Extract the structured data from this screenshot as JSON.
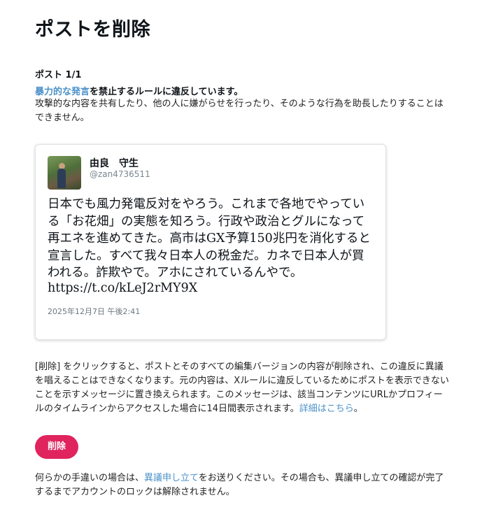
{
  "page": {
    "title": "ポストを削除"
  },
  "post_count": "ポスト 1/1",
  "violation": {
    "rule_link": "暴力的な発言",
    "rule_suffix": "を禁止するルールに違反しています。",
    "description": "攻撃的な内容を共有したり、他の人に嫌がらせを行ったり、そのような行為を助長したりすることはできません。"
  },
  "tweet": {
    "display_name": "由良　守生",
    "handle": "@zan4736511",
    "text": "日本でも風力発電反対をやろう。これまで各地でやっている「お花畑」の実態を知ろう。行政や政治とグルになって再エネを進めてきた。高市はGX予算150兆円を消化すると宣言した。すべて我々日本人の税金だ。カネで日本人が買われる。詐欺やで。アホにされているんやで。",
    "link": "https://t.co/kLeJ2rMY9X",
    "date": "2025年12月7日 午後2:41"
  },
  "info": {
    "text": "[削除] をクリックすると、ポストとそのすべての編集バージョンの内容が削除され、この違反に異議を唱えることはできなくなります。元の内容は、Xルールに違反しているためにポストを表示できないことを示すメッセージに置き換えられます。このメッセージは、該当コンテンツにURLかプロフィールのタイムラインからアクセスした場合に14日間表示されます。",
    "details_link": "詳細はこちら",
    "trailing": "。"
  },
  "delete_button": {
    "label": "削除"
  },
  "appeal": {
    "prefix": "何らかの手違いの場合は、",
    "link": "異議申し立て",
    "suffix": "をお送りください。その場合も、異議申し立ての確認が完了するまでアカウントのロックは解除されません。"
  },
  "colors": {
    "link": "#4a90c9",
    "danger_button": "#e0245e"
  }
}
